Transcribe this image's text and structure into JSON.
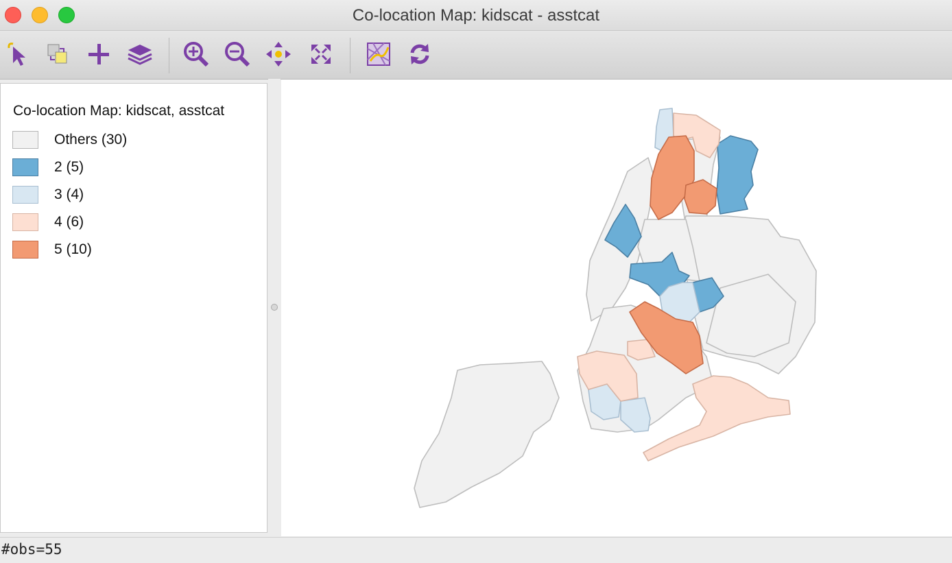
{
  "window": {
    "title": "Co-location Map: kidscat - asstcat"
  },
  "toolbar": {
    "tools": [
      {
        "icon": "select-pointer-icon"
      },
      {
        "icon": "selection-shape-icon"
      },
      {
        "icon": "add-plus-icon"
      },
      {
        "icon": "layers-icon"
      },
      {
        "icon": "zoom-in-icon"
      },
      {
        "icon": "zoom-out-icon"
      },
      {
        "icon": "pan-icon"
      },
      {
        "icon": "full-extent-icon"
      },
      {
        "icon": "basemap-icon"
      },
      {
        "icon": "refresh-icon"
      }
    ]
  },
  "legend": {
    "title": "Co-location Map: kidscat, asstcat",
    "items": [
      {
        "label": "Others (30)",
        "color": "#f1f1f1",
        "border": "#b5b5b5"
      },
      {
        "label": "2 (5)",
        "color": "#6baed6",
        "border": "#4a7fa3"
      },
      {
        "label": "3 (4)",
        "color": "#d8e7f2",
        "border": "#a9bfd1"
      },
      {
        "label": "4 (6)",
        "color": "#fddfd2",
        "border": "#d8b4a4"
      },
      {
        "label": "5 (10)",
        "color": "#f29a72",
        "border": "#c56b47"
      }
    ]
  },
  "status": {
    "text": "#obs=55"
  }
}
